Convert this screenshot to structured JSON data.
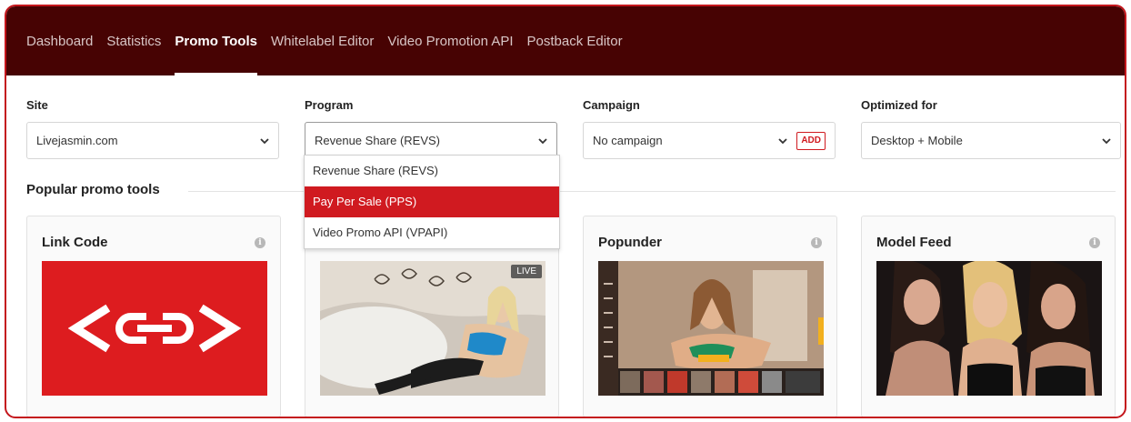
{
  "nav": {
    "items": [
      "Dashboard",
      "Statistics",
      "Promo Tools",
      "Whitelabel Editor",
      "Video Promotion API",
      "Postback Editor"
    ],
    "active": "Promo Tools"
  },
  "filters": {
    "site": {
      "label": "Site",
      "value": "Livejasmin.com"
    },
    "program": {
      "label": "Program",
      "value": "Revenue Share (REVS)"
    },
    "campaign": {
      "label": "Campaign",
      "value": "No campaign",
      "add_label": "ADD"
    },
    "optimized": {
      "label": "Optimized for",
      "value": "Desktop + Mobile"
    }
  },
  "program_dropdown": {
    "options": [
      "Revenue Share (REVS)",
      "Pay Per Sale (PPS)",
      "Video Promo API (VPAPI)"
    ],
    "highlighted": "Pay Per Sale (PPS)"
  },
  "section": {
    "title": "Popular promo tools"
  },
  "cards": [
    {
      "title": "Link Code",
      "info": "i"
    },
    {
      "title": "",
      "badge": "LIVE"
    },
    {
      "title": "Popunder",
      "info": "i"
    },
    {
      "title": "Model Feed",
      "info": "i"
    }
  ],
  "colors": {
    "nav_bg": "#470303",
    "accent": "#d01a20",
    "frame_border": "#c4161c"
  }
}
